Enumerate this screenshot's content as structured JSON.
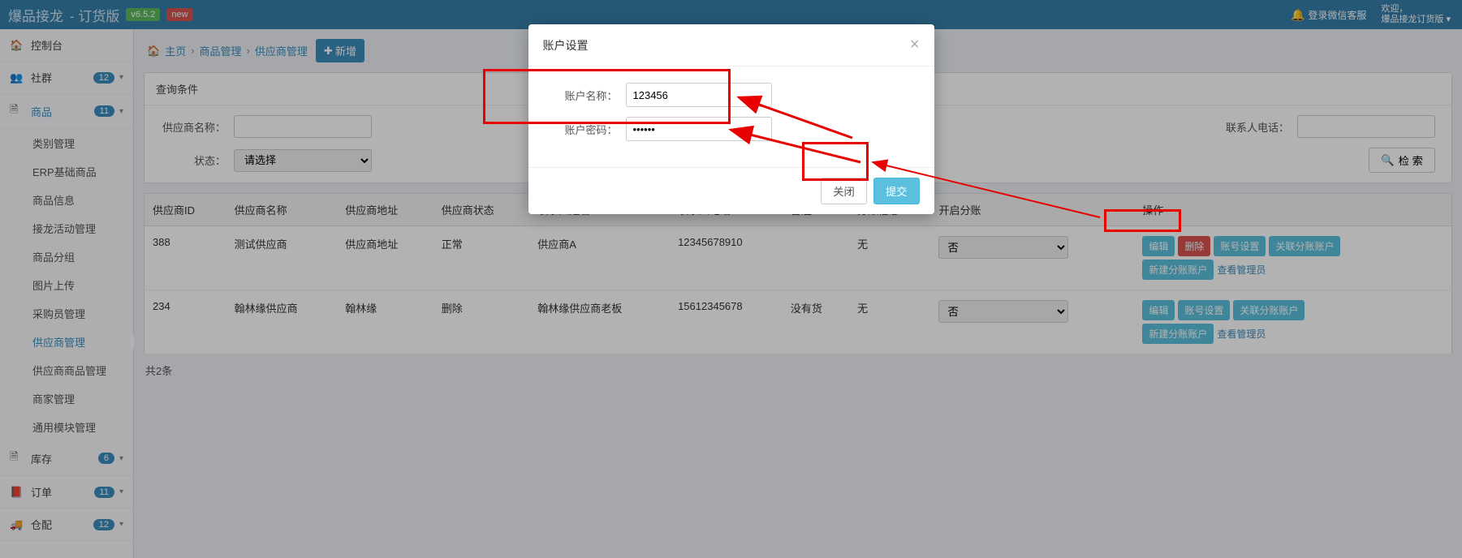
{
  "header": {
    "brand": "爆品接龙",
    "subtitle": "- 订货版",
    "version": "v6.5.2",
    "new_badge": "new",
    "login_wechat": "登录微信客服",
    "welcome_line1": "欢迎，",
    "welcome_line2": "爆品接龙订货版"
  },
  "sidebar": {
    "items": [
      {
        "icon": "⚙",
        "label": "控制台",
        "badge": null
      },
      {
        "icon": "👥",
        "label": "社群",
        "badge": "12"
      },
      {
        "icon": "📄",
        "label": "商品",
        "badge": "11",
        "blue": true
      },
      {
        "icon": "📄",
        "label": "库存",
        "badge": "6"
      },
      {
        "icon": "📕",
        "label": "订单",
        "badge": "11"
      },
      {
        "icon": "🚚",
        "label": "仓配",
        "badge": "12"
      }
    ],
    "sub_items": [
      {
        "label": "类别管理"
      },
      {
        "label": "ERP基础商品"
      },
      {
        "label": "商品信息"
      },
      {
        "label": "接龙活动管理"
      },
      {
        "label": "商品分组"
      },
      {
        "label": "图片上传"
      },
      {
        "label": "采购员管理"
      },
      {
        "label": "供应商管理",
        "active": true
      },
      {
        "label": "供应商商品管理"
      },
      {
        "label": "商家管理"
      },
      {
        "label": "通用模块管理"
      }
    ]
  },
  "breadcrumb": {
    "home": "主页",
    "level1": "商品管理",
    "level2": "供应商管理",
    "add_btn": "新增"
  },
  "filter": {
    "panel_title": "查询条件",
    "supplier_name_label": "供应商名称：",
    "supplier_name_value": "",
    "contact_phone_label": "联系人电话：",
    "contact_phone_value": "",
    "status_label": "状态：",
    "status_placeholder": "请选择",
    "search_btn": "检 索"
  },
  "table": {
    "headers": [
      "供应商ID",
      "供应商名称",
      "供应商地址",
      "供应商状态",
      "联系人姓名",
      "联系人电话",
      "备注",
      "分账信息",
      "开启分账",
      "操作"
    ],
    "rows": [
      {
        "id": "388",
        "name": "测试供应商",
        "address": "供应商地址",
        "status": "正常",
        "contact_name": "供应商A",
        "contact_phone": "12345678910",
        "remark": "",
        "split_info": "无",
        "split_toggle": "否",
        "actions": {
          "edit": "编辑",
          "delete": "删除",
          "account_set": "账号设置",
          "link_split": "关联分账账户",
          "new_split": "新建分账账户",
          "view_admin": "查看管理员"
        }
      },
      {
        "id": "234",
        "name": "翰林缘供应商",
        "address": "翰林缘",
        "status": "删除",
        "contact_name": "翰林缘供应商老板",
        "contact_phone": "15612345678",
        "remark": "没有货",
        "split_info": "无",
        "split_toggle": "否",
        "actions": {
          "edit": "编辑",
          "account_set": "账号设置",
          "link_split": "关联分账账户",
          "new_split": "新建分账账户",
          "view_admin": "查看管理员"
        }
      }
    ],
    "total": "共2条"
  },
  "modal": {
    "title": "账户设置",
    "name_label": "账户名称：",
    "name_value": "123456",
    "password_label": "账户密码：",
    "password_value": "••••••",
    "close_btn": "关闭",
    "submit_btn": "提交"
  }
}
